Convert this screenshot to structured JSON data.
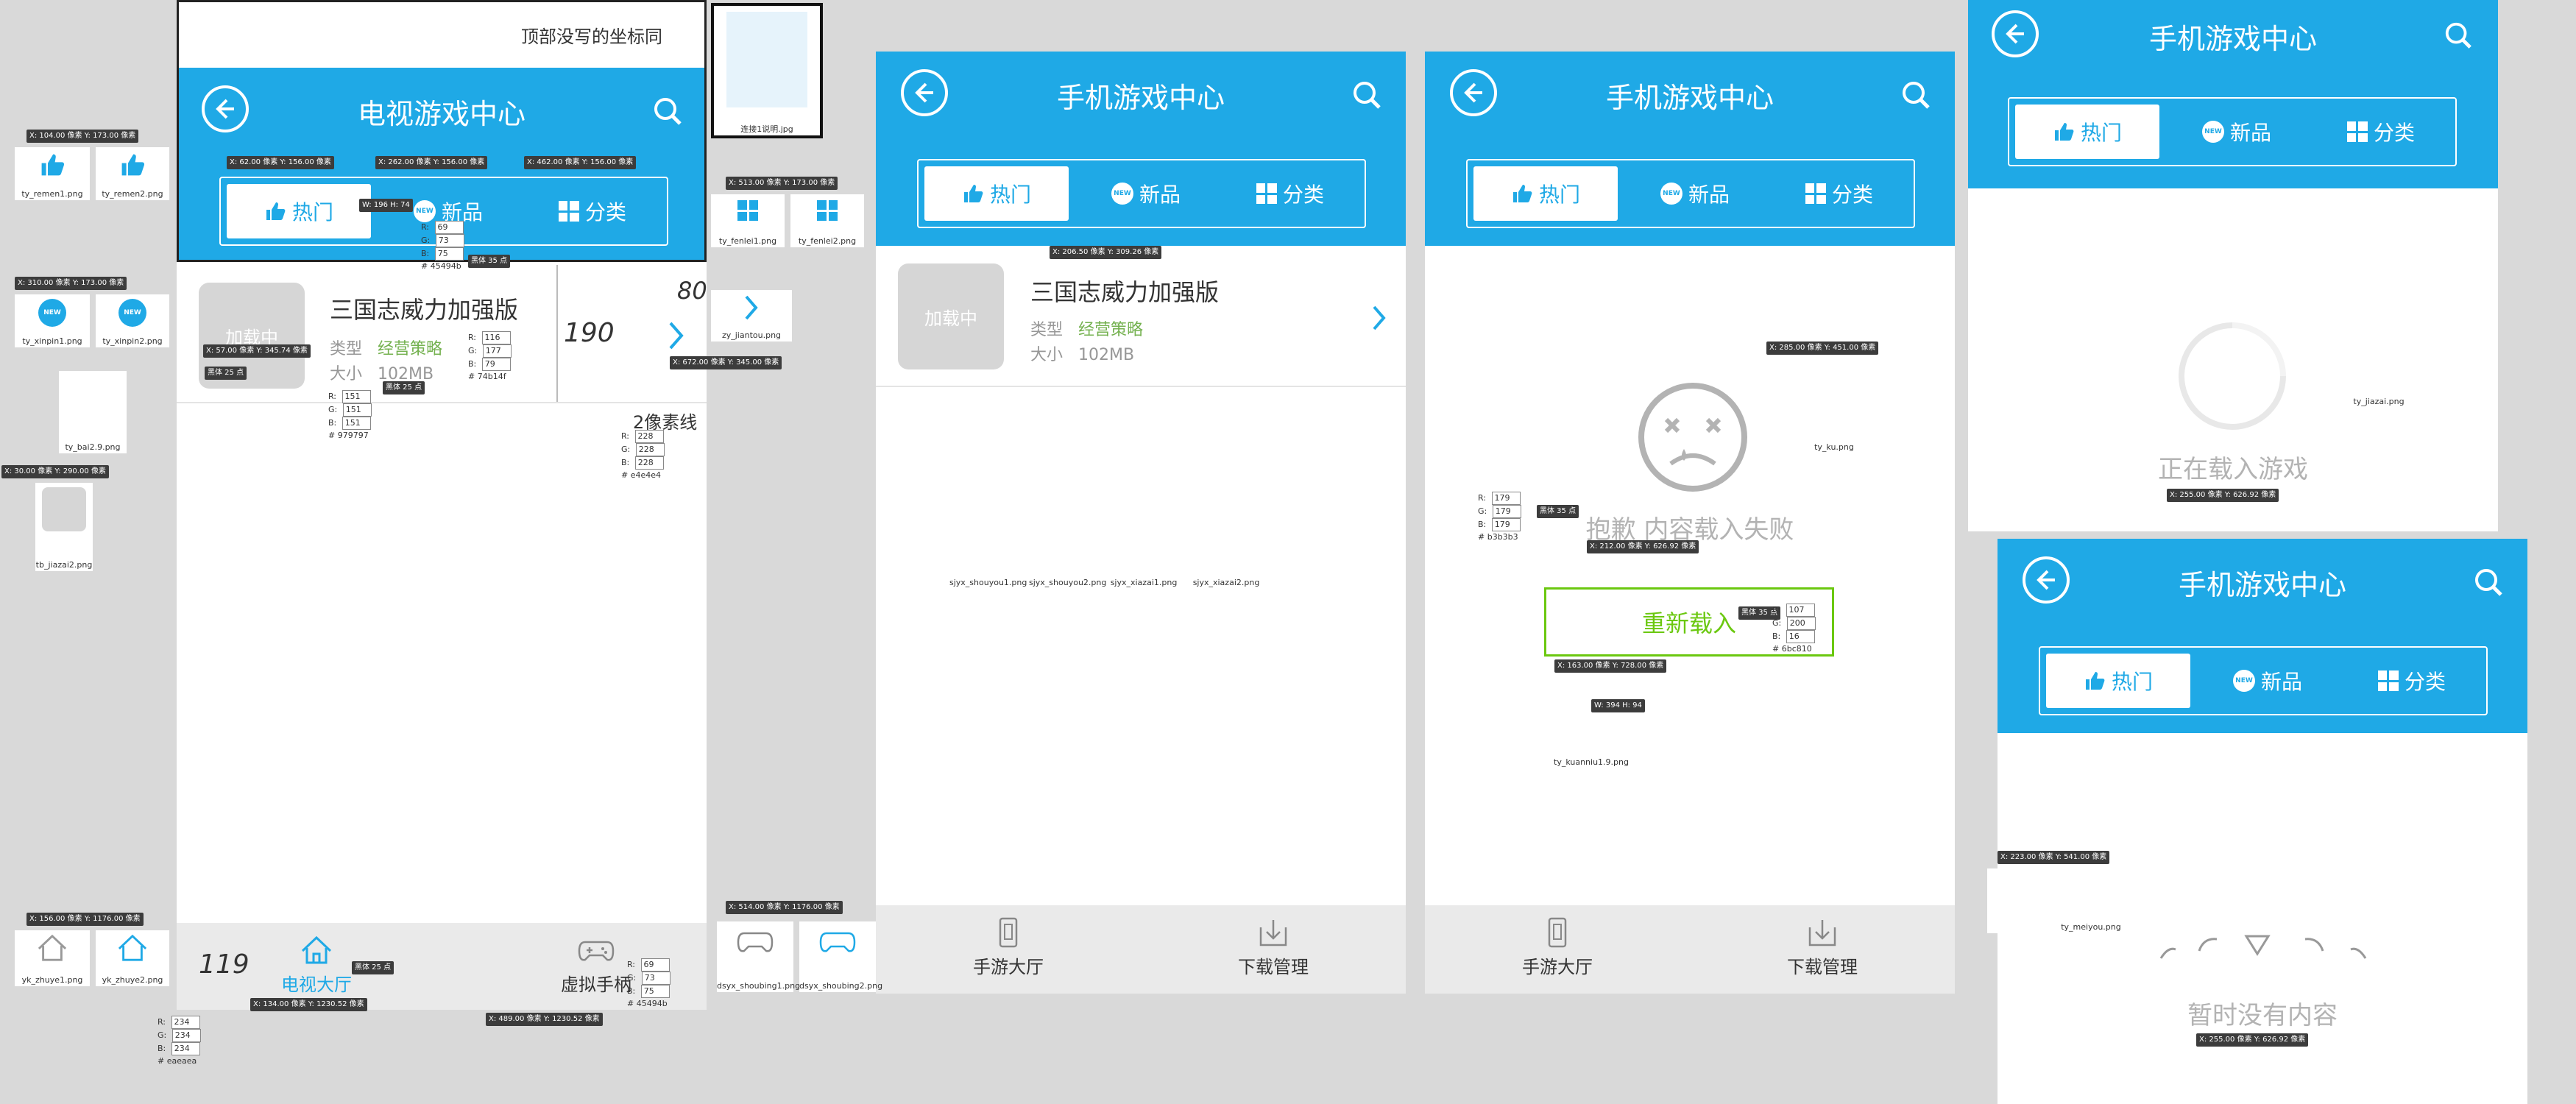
{
  "mock1": {
    "title": "电视游戏中心",
    "tabs": [
      "热门",
      "新品",
      "分类"
    ],
    "note": "顶部没写的坐标同",
    "game": {
      "thumb": "加载中",
      "title": "三国志威力加强版",
      "type_label": "类型",
      "genre": "经营策略",
      "size_label": "大小",
      "size": "102MB"
    },
    "nav": [
      "电视大厅",
      "虚拟手柄"
    ]
  },
  "mock2": {
    "title": "手机游戏中心",
    "tabs": [
      "热门",
      "新品",
      "分类"
    ],
    "game": {
      "thumb": "加载中",
      "title": "三国志威力加强版",
      "type_label": "类型",
      "genre": "经营策略",
      "size_label": "大小",
      "size": "102MB"
    },
    "nav": [
      "手游大厅",
      "下载管理"
    ]
  },
  "mock3": {
    "title": "手机游戏中心",
    "tabs": [
      "热门",
      "新品",
      "分类"
    ],
    "fail": "抱歉  内容载入失败",
    "reload": "重新载入",
    "nav": [
      "手游大厅",
      "下载管理"
    ]
  },
  "mock4": {
    "title": "手机游戏中心",
    "tabs": [
      "热门",
      "新品",
      "分类"
    ],
    "loading": "正在载入游戏"
  },
  "mock5": {
    "title": "手机游戏中心",
    "tabs": [
      "热门",
      "新品",
      "分类"
    ],
    "empty": "暂时没有内容"
  },
  "assets": {
    "ty_remen1": "ty_remen1.png",
    "ty_remen2": "ty_remen2.png",
    "ty_xinpin1": "ty_xinpin1.png",
    "ty_xinpin2": "ty_xinpin2.png",
    "ty_bai2": "ty_bai2.9.png",
    "tb_jiazai2": "tb_jiazai2.png",
    "yk_zhuye1": "yk_zhuye1.png",
    "yk_zhuye2": "yk_zhuye2.png",
    "lianjie": "连接1说明.jpg",
    "ty_fenlei1": "ty_fenlei1.png",
    "ty_fenlei2": "ty_fenlei2.png",
    "zy_jiantou": "zy_jiantou.png",
    "dsyx_shoubing1": "dsyx_shoubing1.png",
    "dsyx_shoubing2": "dsyx_shoubing2.png",
    "sjyx_shouyou1": "sjyx_shouyou1.png",
    "sjyx_shouyou2": "sjyx_shouyou2.png",
    "sjyx_xiazai1": "sjyx_xiazai1.png",
    "sjyx_xiazai2": "sjyx_xiazai2.png",
    "ty_ku": "ty_ku.png",
    "ty_kuanniu1": "ty_kuanniu1.9.png",
    "ty_jiazai": "ty_jiazai.png",
    "ty_meiyou": "ty_meiyou.png"
  },
  "coords": {
    "c1": "X: 104.00 像素  Y: 173.00 像素",
    "c2": "X: 62.00 像素  Y: 156.00 像素",
    "c3": "X: 262.00 像素  Y: 156.00 像素",
    "c4": "X: 462.00 像素  Y: 156.00 像素",
    "c5": "X: 310.00 像素  Y: 173.00 像素",
    "c6": "X: 57.00 像素  Y: 345.74 像素",
    "c7": "X: 30.00 像素  Y: 290.00 像素",
    "c8": "X: 156.00 像素  Y: 1176.00 像素",
    "c9": "X: 134.00 像素  Y: 1230.52 像素",
    "c10": "X: 489.00 像素  Y: 1230.52 像素",
    "c11": "X: 513.00 像素  Y: 173.00 像素",
    "c12": "X: 672.00 像素  Y: 345.00 像素",
    "c13": "X: 514.00 像素  Y: 1176.00 像素",
    "c14": "X: 206.50 像素  Y: 309.26 像素",
    "c15": "X: 285.00 像素  Y: 451.00 像素",
    "c16": "X: 212.00 像素  Y: 626.92 像素",
    "c17": "X: 163.00 像素  Y: 728.00 像素",
    "c18": "X: 255.00 像素  Y: 626.92 像素",
    "c19": "X: 223.00 像素  Y: 541.00 像素",
    "c20": "X: 255.00 像素  Y: 626.92 像素",
    "wh1": "W: 196  H: 74",
    "wh2": "W: 394  H: 94",
    "font1": "黑体  35 点",
    "font2": "黑体  25 点",
    "font3": "黑体  25 点",
    "font4": "黑体  25 点",
    "font5": "黑体  35 点",
    "font6": "黑体  35 点"
  },
  "colors": {
    "accent": "#1fa9e6",
    "green": "#74b14f",
    "gray": "#979797",
    "line": "#e4e4e4",
    "fail": "#b3b3b3",
    "reload": "#6bc810",
    "nav_bg": "#eaeaea",
    "tab_text": "#45494b"
  },
  "swatches": {
    "s1": {
      "r": "69",
      "g": "73",
      "b": "75",
      "hex": "45494b"
    },
    "s2": {
      "r": "116",
      "g": "177",
      "b": "79",
      "hex": "74b14f"
    },
    "s3": {
      "r": "151",
      "g": "151",
      "b": "151",
      "hex": "979797"
    },
    "s4": {
      "r": "228",
      "g": "228",
      "b": "228",
      "hex": "e4e4e4"
    },
    "s5": {
      "r": "69",
      "g": "73",
      "b": "75",
      "hex": "45494b"
    },
    "s6": {
      "r": "234",
      "g": "234",
      "b": "234",
      "hex": "eaeaea"
    },
    "s7": {
      "r": "179",
      "g": "179",
      "b": "179",
      "hex": "b3b3b3"
    },
    "s8": {
      "r": "107",
      "g": "200",
      "b": "16",
      "hex": "6bc810"
    }
  },
  "hand": {
    "h80": "80",
    "h190": "190",
    "h119": "119",
    "h2px": "2像素线",
    "h25": "25",
    "h25b": "25"
  }
}
